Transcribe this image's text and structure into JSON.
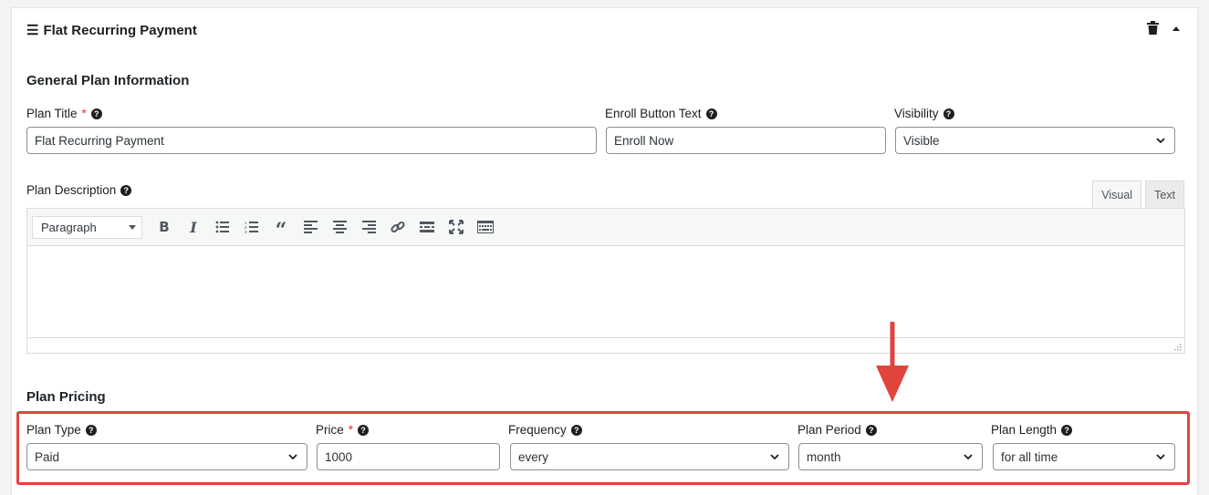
{
  "header": {
    "title": "Flat Recurring Payment",
    "menu_icon": "hamburger-icon",
    "delete_icon": "trash-icon",
    "collapse_icon": "caret-up-icon"
  },
  "general": {
    "section_title": "General Plan Information",
    "plan_title": {
      "label": "Plan Title",
      "required": "*",
      "value": "Flat Recurring Payment"
    },
    "enroll_text": {
      "label": "Enroll Button Text",
      "value": "Enroll Now"
    },
    "visibility": {
      "label": "Visibility",
      "value": "Visible"
    },
    "description": {
      "label": "Plan Description"
    }
  },
  "editor": {
    "tabs": {
      "visual": "Visual",
      "text": "Text"
    },
    "format_select": "Paragraph",
    "tools": [
      "bold-icon",
      "italic-icon",
      "bullet-list-icon",
      "numbered-list-icon",
      "blockquote-icon",
      "align-left-icon",
      "align-center-icon",
      "align-right-icon",
      "link-icon",
      "read-more-icon",
      "fullscreen-icon",
      "toolbar-toggle-icon"
    ]
  },
  "pricing": {
    "section_title": "Plan Pricing",
    "plan_type": {
      "label": "Plan Type",
      "value": "Paid"
    },
    "price": {
      "label": "Price",
      "required": "*",
      "value": "1000"
    },
    "frequency": {
      "label": "Frequency",
      "value": "every"
    },
    "plan_period": {
      "label": "Plan Period",
      "value": "month"
    },
    "plan_length": {
      "label": "Plan Length",
      "value": "for all time"
    }
  },
  "annotation": {
    "highlight_color": "#e0443c"
  }
}
